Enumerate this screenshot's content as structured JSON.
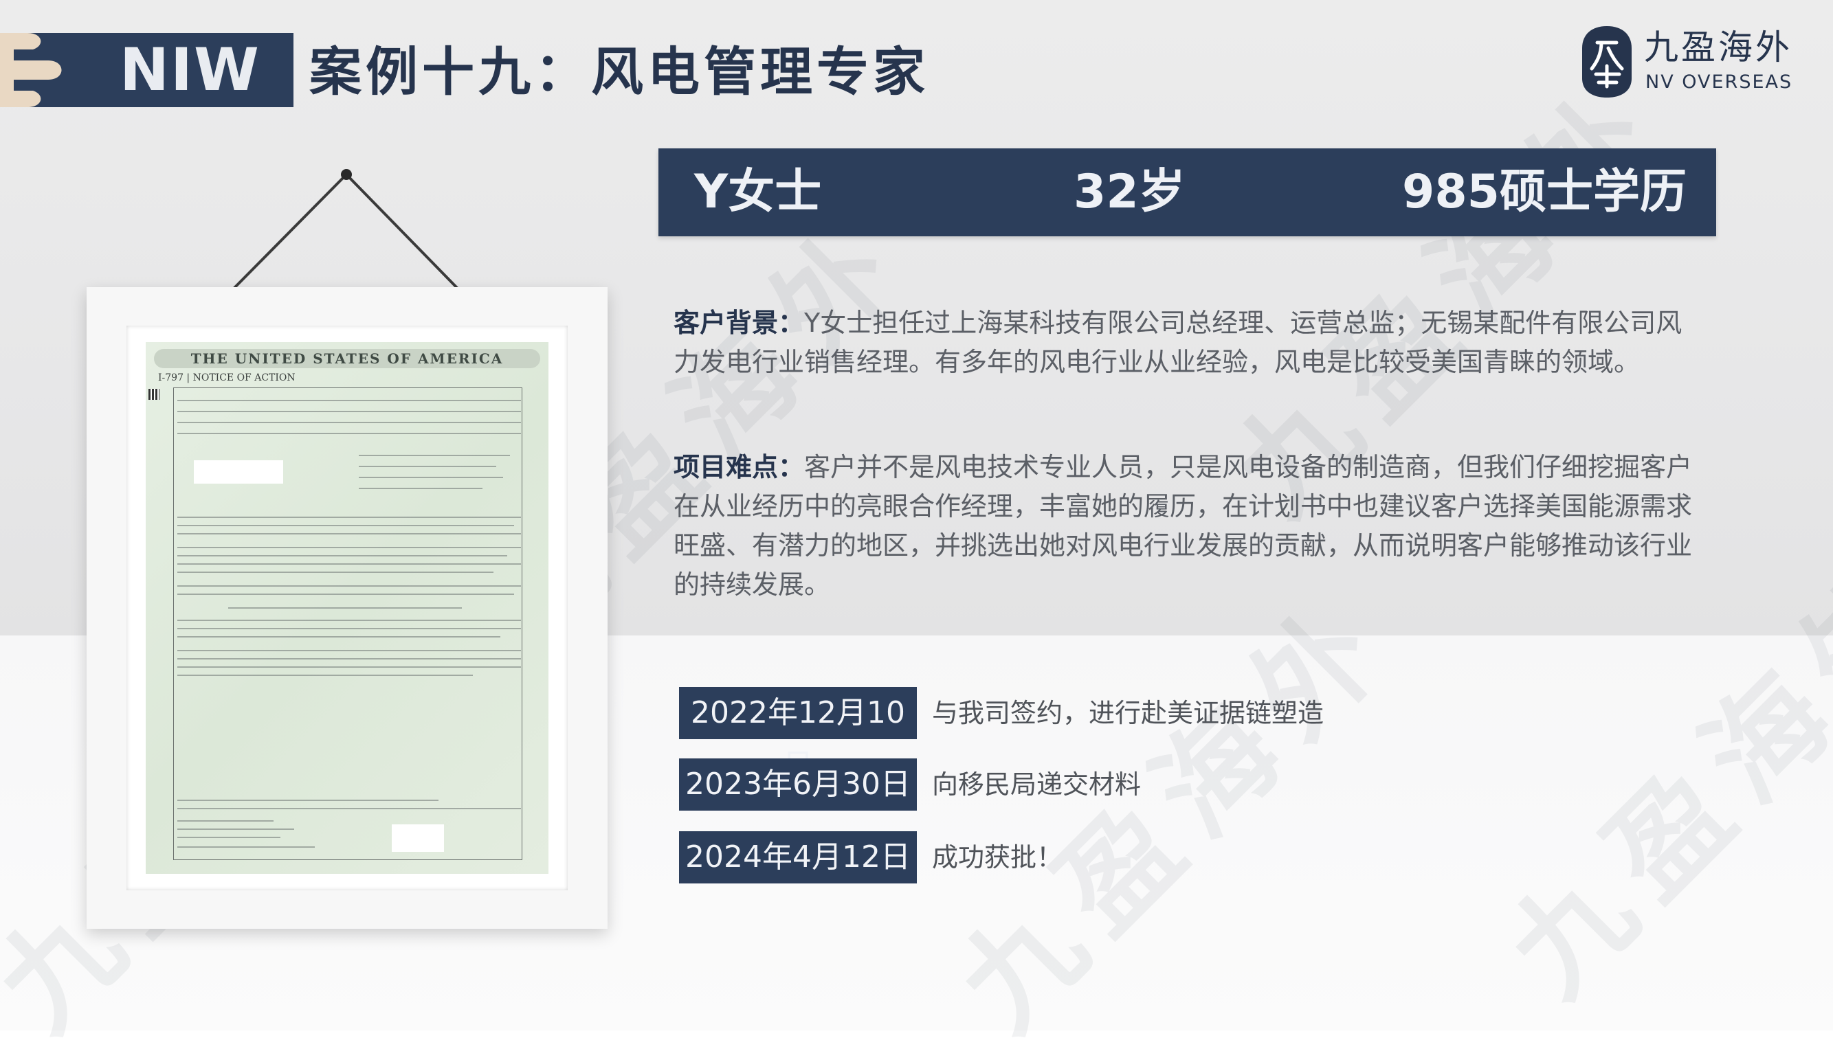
{
  "header": {
    "tag": "NIW",
    "title": "案例十九：风电管理专家"
  },
  "logo": {
    "name_cn": "九盈海外",
    "name_en": "NV OVERSEAS"
  },
  "profile": {
    "name": "Y女士",
    "age": "32岁",
    "education": "985硕士学历"
  },
  "background": {
    "label": "客户背景：",
    "text": "Y女士担任过上海某科技有限公司总经理、运营总监；无锡某配件有限公司风力发电行业销售经理。有多年的风电行业从业经验，风电是比较受美国青睐的领域。"
  },
  "difficulty": {
    "label": "项目难点：",
    "text": "客户并不是风电技术专业人员，只是风电设备的制造商，但我们仔细挖掘客户在从业经历中的亮眼合作经理，丰富她的履历，在计划书中也建议客户选择美国能源需求旺盛、有潜力的地区，并挑选出她对风电行业发展的贡献，从而说明客户能够推动该行业的持续发展。"
  },
  "timeline": [
    {
      "date": "2022年12月10日",
      "desc": "与我司签约，进行赴美证据链塑造"
    },
    {
      "date": "2023年6月30日",
      "desc": "向移民局递交材料"
    },
    {
      "date": "2024年4月12日",
      "desc": "成功获批！"
    }
  ],
  "document": {
    "heading": "THE UNITED STATES OF AMERICA",
    "subheading": "I-797 | NOTICE OF ACTION"
  },
  "watermark": "九盈海外",
  "colors": {
    "navy": "#2c3e5b",
    "title_text": "#26344d",
    "body_text": "#5b5f66"
  }
}
